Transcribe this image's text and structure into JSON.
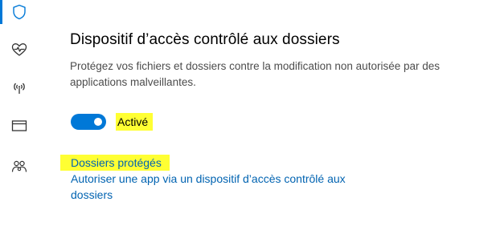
{
  "nav": {
    "items": [
      {
        "icon": "shield-icon",
        "selected": true
      },
      {
        "icon": "heart-pulse-icon",
        "selected": false
      },
      {
        "icon": "wireless-antenna-icon",
        "selected": false
      },
      {
        "icon": "app-browser-window-icon",
        "selected": false
      },
      {
        "icon": "family-people-icon",
        "selected": false
      }
    ],
    "accent_color": "#0078d7"
  },
  "section": {
    "title": "Dispositif d’accès contrôlé aux dossiers",
    "description": "Protégez vos fichiers et dossiers contre la modification non autorisée par des applications malveillantes.",
    "toggle": {
      "state": "on",
      "label": "Activé"
    },
    "links": {
      "protected_folders": "Dossiers protégés",
      "allow_app": "Autoriser une app via un dispositif d’accès contrôlé aux dossiers"
    }
  },
  "colors": {
    "link": "#0063b1",
    "highlight": "#ffff33",
    "toggle_on": "#0078d7"
  }
}
